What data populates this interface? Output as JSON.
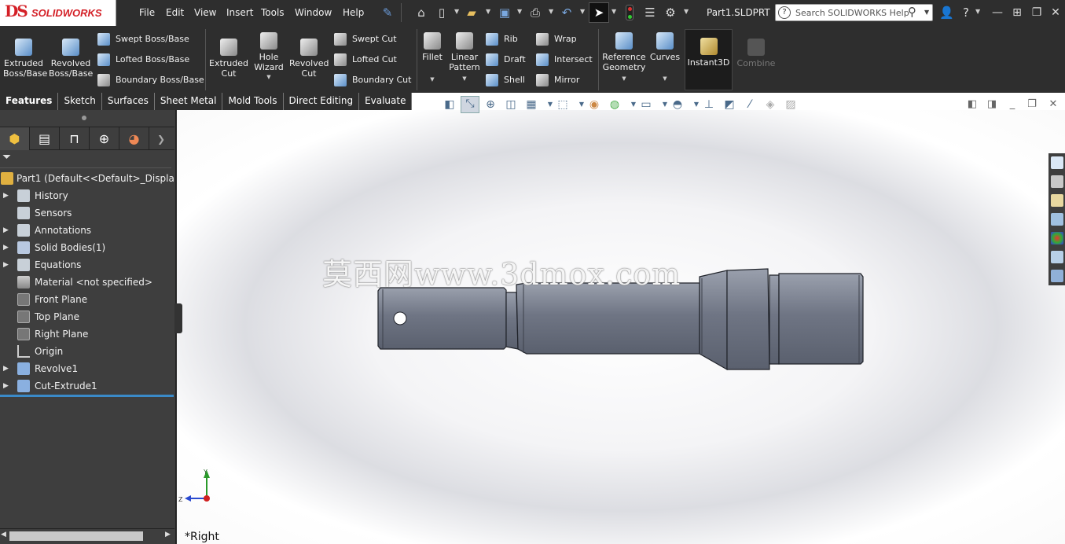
{
  "app": {
    "brand": "SOLIDWORKS",
    "logo_mark": "DS",
    "doc_title": "Part1.SLDPRT"
  },
  "menu": [
    "File",
    "Edit",
    "View",
    "Insert",
    "Tools",
    "Window",
    "Help"
  ],
  "search": {
    "placeholder": "Search SOLIDWORKS Help"
  },
  "ribbon": {
    "extruded_boss": "Extruded Boss/Base",
    "revolved_boss": "Revolved Boss/Base",
    "swept_boss": "Swept Boss/Base",
    "lofted_boss": "Lofted Boss/Base",
    "boundary_boss": "Boundary Boss/Base",
    "extruded_cut": "Extruded Cut",
    "hole_wizard": "Hole Wizard",
    "revolved_cut": "Revolved Cut",
    "swept_cut": "Swept Cut",
    "lofted_cut": "Lofted Cut",
    "boundary_cut": "Boundary Cut",
    "fillet": "Fillet",
    "linear_pattern": "Linear Pattern",
    "rib": "Rib",
    "draft": "Draft",
    "shell": "Shell",
    "wrap": "Wrap",
    "intersect": "Intersect",
    "mirror": "Mirror",
    "reference_geometry": "Reference Geometry",
    "curves": "Curves",
    "instant3d": "Instant3D",
    "combine": "Combine"
  },
  "tabs": [
    {
      "label": "Features",
      "active": true
    },
    {
      "label": "Sketch",
      "active": false
    },
    {
      "label": "Surfaces",
      "active": false
    },
    {
      "label": "Sheet Metal",
      "active": false
    },
    {
      "label": "Mold Tools",
      "active": false
    },
    {
      "label": "Direct Editing",
      "active": false
    },
    {
      "label": "Evaluate",
      "active": false
    }
  ],
  "tree": {
    "root": "Part1  (Default<<Default>_Display Sta",
    "items": [
      {
        "label": "History",
        "expandable": true,
        "icon": "history-icon"
      },
      {
        "label": "Sensors",
        "expandable": false,
        "icon": "sensors-icon"
      },
      {
        "label": "Annotations",
        "expandable": true,
        "icon": "annotations-icon"
      },
      {
        "label": "Solid Bodies(1)",
        "expandable": true,
        "icon": "solid-bodies-icon"
      },
      {
        "label": "Equations",
        "expandable": true,
        "icon": "equations-icon"
      },
      {
        "label": "Material <not specified>",
        "expandable": false,
        "icon": "material-icon"
      },
      {
        "label": "Front Plane",
        "expandable": false,
        "icon": "plane-icon"
      },
      {
        "label": "Top Plane",
        "expandable": false,
        "icon": "plane-icon"
      },
      {
        "label": "Right Plane",
        "expandable": false,
        "icon": "plane-icon"
      },
      {
        "label": "Origin",
        "expandable": false,
        "icon": "origin-icon"
      },
      {
        "label": "Revolve1",
        "expandable": true,
        "icon": "revolve-icon"
      },
      {
        "label": "Cut-Extrude1",
        "expandable": true,
        "icon": "cut-extrude-icon"
      }
    ]
  },
  "viewport": {
    "watermark": "莫西网www.3dmox.com",
    "view_name": "*Right",
    "triad": {
      "y": "Y",
      "z": "Z"
    }
  },
  "colors": {
    "accent": "#3a8ac8",
    "brand_red": "#d42027",
    "part_fill": "#7a7f8c"
  }
}
